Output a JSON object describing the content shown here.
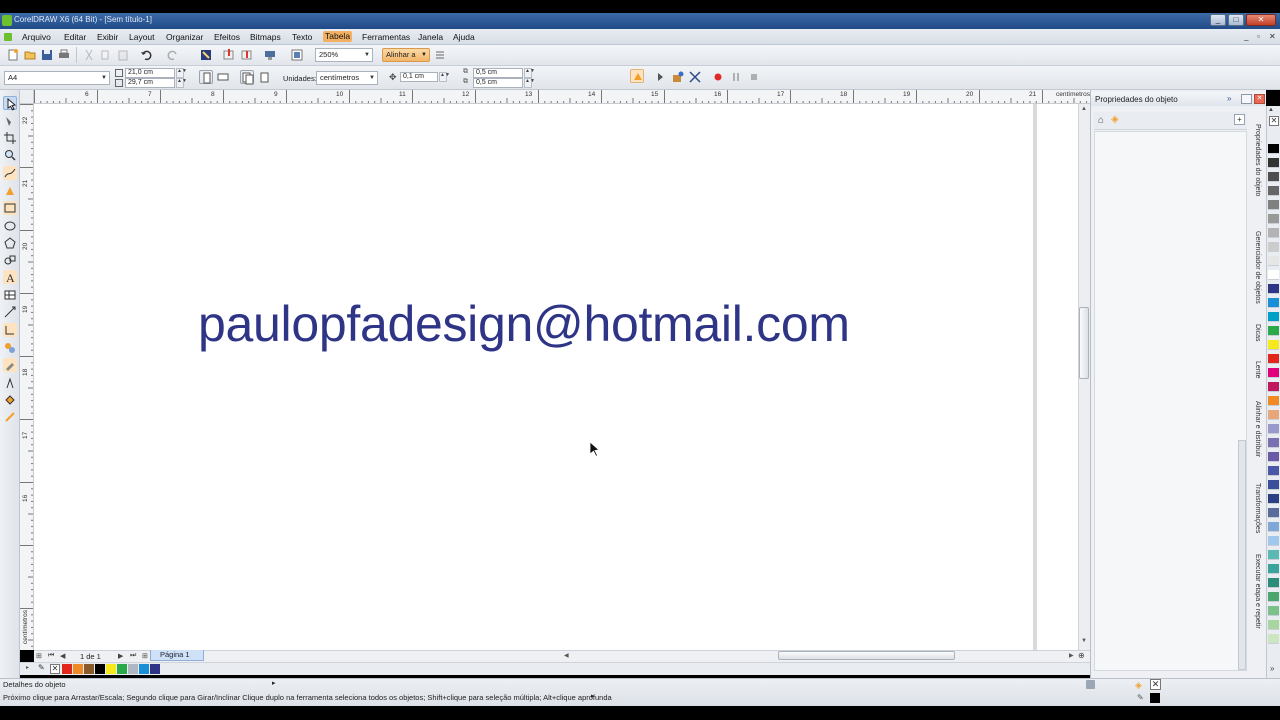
{
  "window": {
    "title": "CorelDRAW X6 (64 Bit) - [Sem título-1]"
  },
  "menu": {
    "items": [
      "Arquivo",
      "Editar",
      "Exibir",
      "Layout",
      "Organizar",
      "Efeitos",
      "Bitmaps",
      "Texto",
      "Tabela",
      "Ferramentas",
      "Janela",
      "Ajuda"
    ],
    "active": "Tabela"
  },
  "toolbar": {
    "zoom": "250%",
    "align_label": "Alinhar a"
  },
  "property_bar": {
    "page_size": "A4",
    "width": "21,0 cm",
    "height": "29,7 cm",
    "units_label": "Unidades:",
    "units_value": "centímetros",
    "nudge": "0,1 cm",
    "dup_x": "0,5 cm",
    "dup_y": "0,5 cm"
  },
  "rulers": {
    "h_numbers": [
      "6",
      "7",
      "8",
      "9",
      "10",
      "11",
      "12",
      "13",
      "14",
      "15",
      "16",
      "17",
      "18",
      "19",
      "20",
      "21"
    ],
    "unit_label": "centímetros",
    "v_numbers": [
      "22",
      "21",
      "20",
      "19",
      "18",
      "17",
      "16"
    ]
  },
  "canvas": {
    "text": "paulopfadesign@hotmail.com",
    "text_color": "#2e3486"
  },
  "page_nav": {
    "counter": "1 de 1",
    "page_tab": "Página 1"
  },
  "docker": {
    "title": "Propriedades do objeto",
    "tabs": [
      "Propriedades do objeto",
      "Gerenciador de objetos",
      "Dicas",
      "Lente",
      "Alinhar e distribuir",
      "Transformações",
      "Executar etapa e repetir"
    ]
  },
  "palette_bottom": [
    "#e1261c",
    "#f08a24",
    "#8b5a2b",
    "#000000",
    "#f5e81c",
    "#2aa84a",
    "#b0b7c3",
    "#1a8fd8",
    "#2e3486"
  ],
  "palette_right": [
    "#000000",
    "#333333",
    "#4d4d4d",
    "#666666",
    "#808080",
    "#999999",
    "#b3b3b3",
    "#cccccc",
    "#e6e6e6",
    "#ffffff",
    "#2e3486",
    "#1a8fd8",
    "#00a0c6",
    "#2aa84a",
    "#f5e81c",
    "#e1261c",
    "#e2007a",
    "#c0185c",
    "#f08a24",
    "#e8a77a",
    "#9999cc",
    "#7a6fb0",
    "#6b5aa6",
    "#4a58a8",
    "#3b4f9a",
    "#2c3f82",
    "#5a6d9a",
    "#7fa8d8",
    "#9fc8ea",
    "#5cb8b2",
    "#3aa39c",
    "#2d8b7a",
    "#4da56e",
    "#7cc08a",
    "#a9d6a0",
    "#cde6c2"
  ],
  "status": {
    "line1": "Detalhes do objeto",
    "line2": "Próximo clique para Arrastar/Escala; Segundo clique para Girar/Inclinar Clique duplo na ferramenta seleciona todos os objetos; Shift+clique para seleção múltipla; Alt+clique aprofunda"
  }
}
